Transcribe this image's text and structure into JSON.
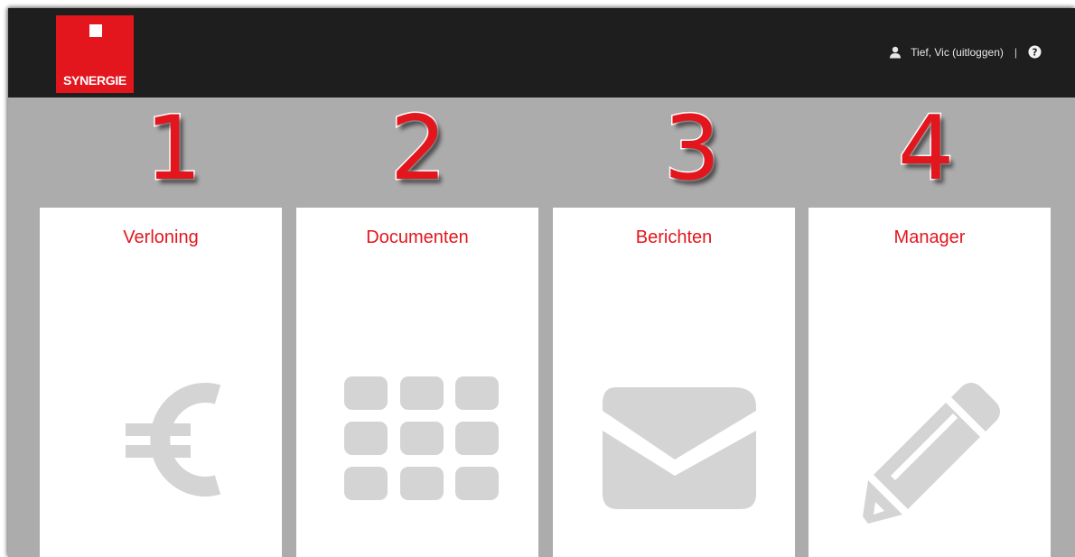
{
  "header": {
    "logo_text": "SYNERGIE",
    "user_label": "Tief, Vic (uitloggen)",
    "separator": "|"
  },
  "numbers": [
    "1",
    "2",
    "3",
    "4"
  ],
  "tiles": [
    {
      "title": "Verloning",
      "icon": "euro-icon"
    },
    {
      "title": "Documenten",
      "icon": "grid-icon"
    },
    {
      "title": "Berichten",
      "icon": "envelope-icon"
    },
    {
      "title": "Manager",
      "icon": "pencil-icon"
    }
  ],
  "colors": {
    "brand_red": "#e3161e",
    "topbar": "#1e1e1e",
    "background": "#acacac",
    "icon_gray": "#d4d4d4"
  }
}
